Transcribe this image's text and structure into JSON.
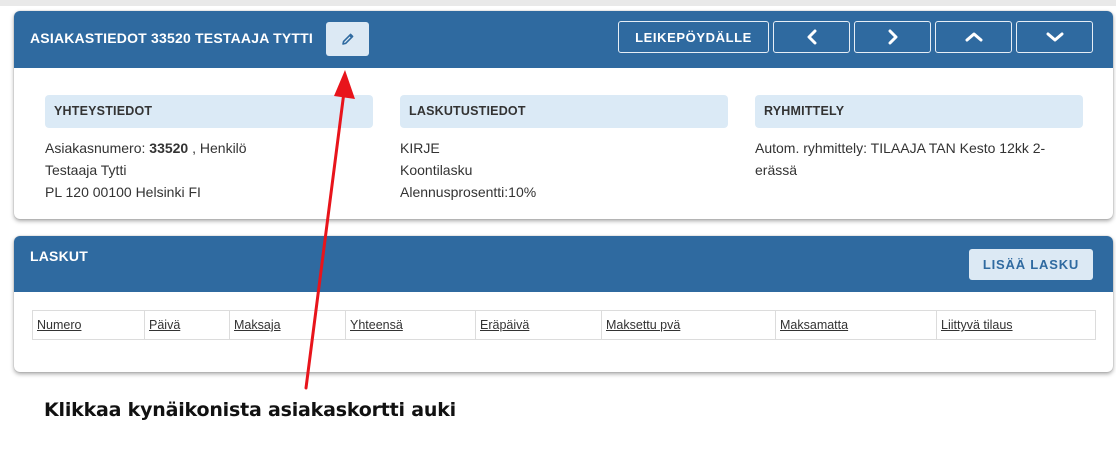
{
  "customer_card": {
    "title": "ASIAKASTIEDOT 33520 TESTAAJA TYTTI",
    "edit_icon": "pencil-icon",
    "clipboard_label": "LEIKEPÖYDÄLLE",
    "nav_icons": [
      "chevron-left-icon",
      "chevron-right-icon",
      "chevron-up-icon",
      "chevron-down-icon"
    ],
    "contact": {
      "heading": "YHTEYSTIEDOT",
      "customer_number_label": "Asiakasnumero: ",
      "customer_number": "33520",
      "customer_type": " , Henkilö",
      "name": "Testaaja Tytti",
      "address": "PL 120 00100 Helsinki FI"
    },
    "billing": {
      "heading": "LASKUTUSTIEDOT",
      "line1": "KIRJE",
      "line2": "Koontilasku",
      "line3": "Alennusprosentti:10%"
    },
    "grouping": {
      "heading": "RYHMITTELY",
      "text": "Autom. ryhmittely: TILAAJA TAN Kesto 12kk 2-erässä"
    }
  },
  "invoices": {
    "title": "LASKUT",
    "add_label": "LISÄÄ LASKU",
    "columns": [
      "Numero",
      "Päivä",
      "Maksaja",
      "Yhteensä",
      "Eräpäivä",
      "Maksettu pvä",
      "Maksamatta",
      "Liittyvä tilaus"
    ]
  },
  "annotation": {
    "text": "Klikkaa kynäikonista asiakaskortti auki",
    "arrow_color": "#e8141b"
  },
  "colors": {
    "header_blue": "#2f6aa0",
    "light_blue": "#dbeaf6"
  }
}
